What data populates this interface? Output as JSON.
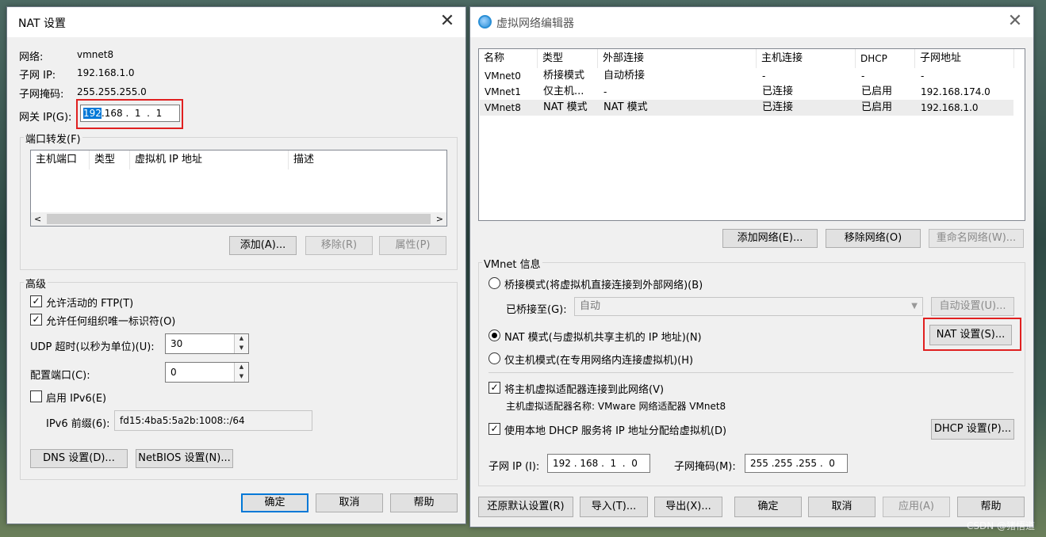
{
  "nat": {
    "title": "NAT 设置",
    "network_label": "网络:",
    "network_value": "vmnet8",
    "subnet_ip_label": "子网 IP:",
    "subnet_ip_value": "192.168.1.0",
    "subnet_mask_label": "子网掩码:",
    "subnet_mask_value": "255.255.255.0",
    "gateway_label": "网关 IP(G):",
    "gateway_octets": [
      "192",
      "168",
      "1",
      "1"
    ],
    "port_forward": {
      "legend": "端口转发(F)",
      "columns": [
        "主机端口",
        "类型",
        "虚拟机 IP 地址",
        "描述"
      ],
      "add": "添加(A)...",
      "remove": "移除(R)",
      "properties": "属性(P)"
    },
    "advanced": {
      "legend": "高级",
      "allow_ftp": "允许活动的 FTP(T)",
      "allow_oui": "允许任何组织唯一标识符(O)",
      "udp_label": "UDP 超时(以秒为单位)(U):",
      "udp_value": "30",
      "port_label": "配置端口(C):",
      "port_value": "0",
      "ipv6_label": "启用 IPv6(E)",
      "ipv6_prefix_label": "IPv6 前缀(6):",
      "ipv6_prefix_value": "fd15:4ba5:5a2b:1008::/64",
      "dns": "DNS 设置(D)...",
      "netbios": "NetBIOS 设置(N)..."
    },
    "ok": "确定",
    "cancel": "取消",
    "help": "帮助"
  },
  "vne": {
    "title": "虚拟网络编辑器",
    "columns": [
      "名称",
      "类型",
      "外部连接",
      "主机连接",
      "DHCP",
      "子网地址"
    ],
    "rows": [
      {
        "name": "VMnet0",
        "type": "桥接模式",
        "ext": "自动桥接",
        "host": "-",
        "dhcp": "-",
        "subnet": "-"
      },
      {
        "name": "VMnet1",
        "type": "仅主机...",
        "ext": "-",
        "host": "已连接",
        "dhcp": "已启用",
        "subnet": "192.168.174.0"
      },
      {
        "name": "VMnet8",
        "type": "NAT 模式",
        "ext": "NAT 模式",
        "host": "已连接",
        "dhcp": "已启用",
        "subnet": "192.168.1.0"
      }
    ],
    "add_network": "添加网络(E)...",
    "remove_network": "移除网络(O)",
    "rename_network": "重命名网络(W)...",
    "info_legend": "VMnet 信息",
    "bridged_radio": "桥接模式(将虚拟机直接连接到外部网络)(B)",
    "bridged_to_label": "已桥接至(G):",
    "bridged_to_value": "自动",
    "auto_settings": "自动设置(U)...",
    "nat_radio": "NAT 模式(与虚拟机共享主机的 IP 地址)(N)",
    "nat_settings": "NAT 设置(S)...",
    "hostonly_radio": "仅主机模式(在专用网络内连接虚拟机)(H)",
    "connect_adapter": "将主机虚拟适配器连接到此网络(V)",
    "adapter_name": "主机虚拟适配器名称: VMware 网络适配器 VMnet8",
    "use_dhcp": "使用本地 DHCP 服务将 IP 地址分配给虚拟机(D)",
    "dhcp_settings": "DHCP 设置(P)...",
    "subnet_ip_label": "子网 IP (I):",
    "subnet_ip_octets": [
      "192",
      "168",
      "1",
      "0"
    ],
    "subnet_mask_label": "子网掩码(M):",
    "subnet_mask_octets": [
      "255",
      "255",
      "255",
      "0"
    ],
    "restore": "还原默认设置(R)",
    "import": "导入(T)...",
    "export": "导出(X)...",
    "ok": "确定",
    "cancel": "取消",
    "apply": "应用(A)",
    "help": "帮助"
  },
  "watermark": "CSDN @猪悟道"
}
